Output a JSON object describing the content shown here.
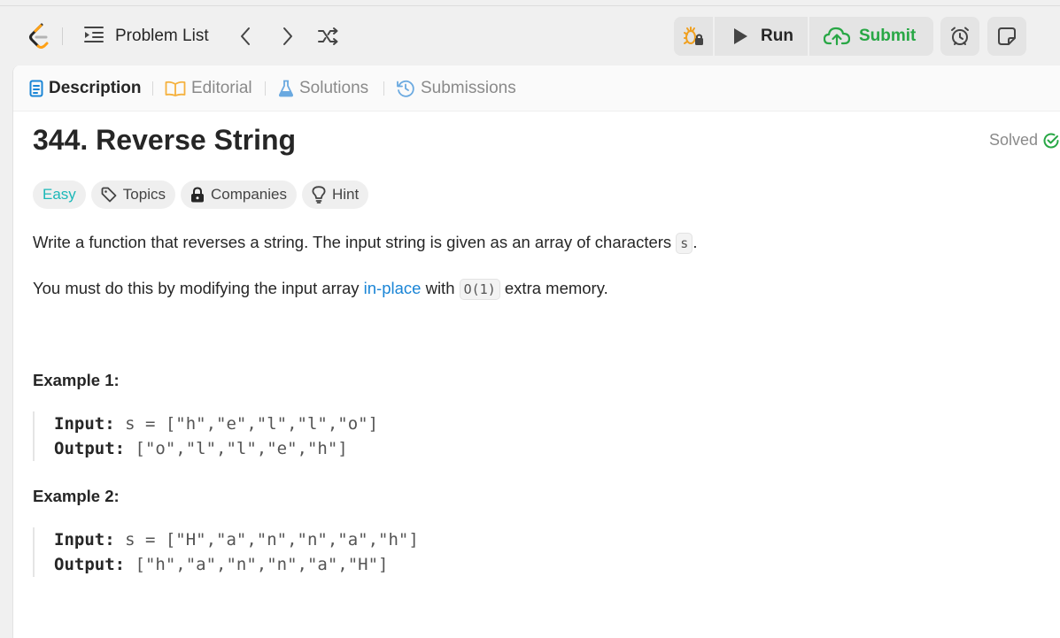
{
  "header": {
    "problem_list_label": "Problem List",
    "run_label": "Run",
    "submit_label": "Submit",
    "colors": {
      "submit": "#28a745",
      "logo_orange": "#ffa116"
    }
  },
  "tabs": [
    {
      "label": "Description",
      "icon": "description-icon",
      "active": true,
      "color": "#1a85d6"
    },
    {
      "label": "Editorial",
      "icon": "book-icon",
      "active": false,
      "color": "#f5b13d"
    },
    {
      "label": "Solutions",
      "icon": "flask-icon",
      "active": false,
      "color": "#1a85d6"
    },
    {
      "label": "Submissions",
      "icon": "history-icon",
      "active": false,
      "color": "#1a85d6"
    }
  ],
  "problem": {
    "title": "344. Reverse String",
    "status": "Solved",
    "status_color": "#28a745",
    "tags": {
      "difficulty": "Easy",
      "difficulty_color": "#1cb8b8",
      "topics": "Topics",
      "companies": "Companies",
      "hint": "Hint"
    },
    "description": {
      "p1_text": "Write a function that reverses a string. The input string is given as an array of characters ",
      "p1_code": "s",
      "p1_end": ".",
      "p2_before": "You must do this by modifying the input array ",
      "p2_link": "in-place",
      "p2_mid": " with ",
      "p2_code": "O(1)",
      "p2_end": " extra memory."
    },
    "examples": [
      {
        "heading": "Example 1:",
        "input_label": "Input:",
        "input_value": " s = [\"h\",\"e\",\"l\",\"l\",\"o\"]",
        "output_label": "Output:",
        "output_value": " [\"o\",\"l\",\"l\",\"e\",\"h\"]"
      },
      {
        "heading": "Example 2:",
        "input_label": "Input:",
        "input_value": " s = [\"H\",\"a\",\"n\",\"n\",\"a\",\"h\"]",
        "output_label": "Output:",
        "output_value": " [\"h\",\"a\",\"n\",\"n\",\"a\",\"H\"]"
      }
    ]
  }
}
